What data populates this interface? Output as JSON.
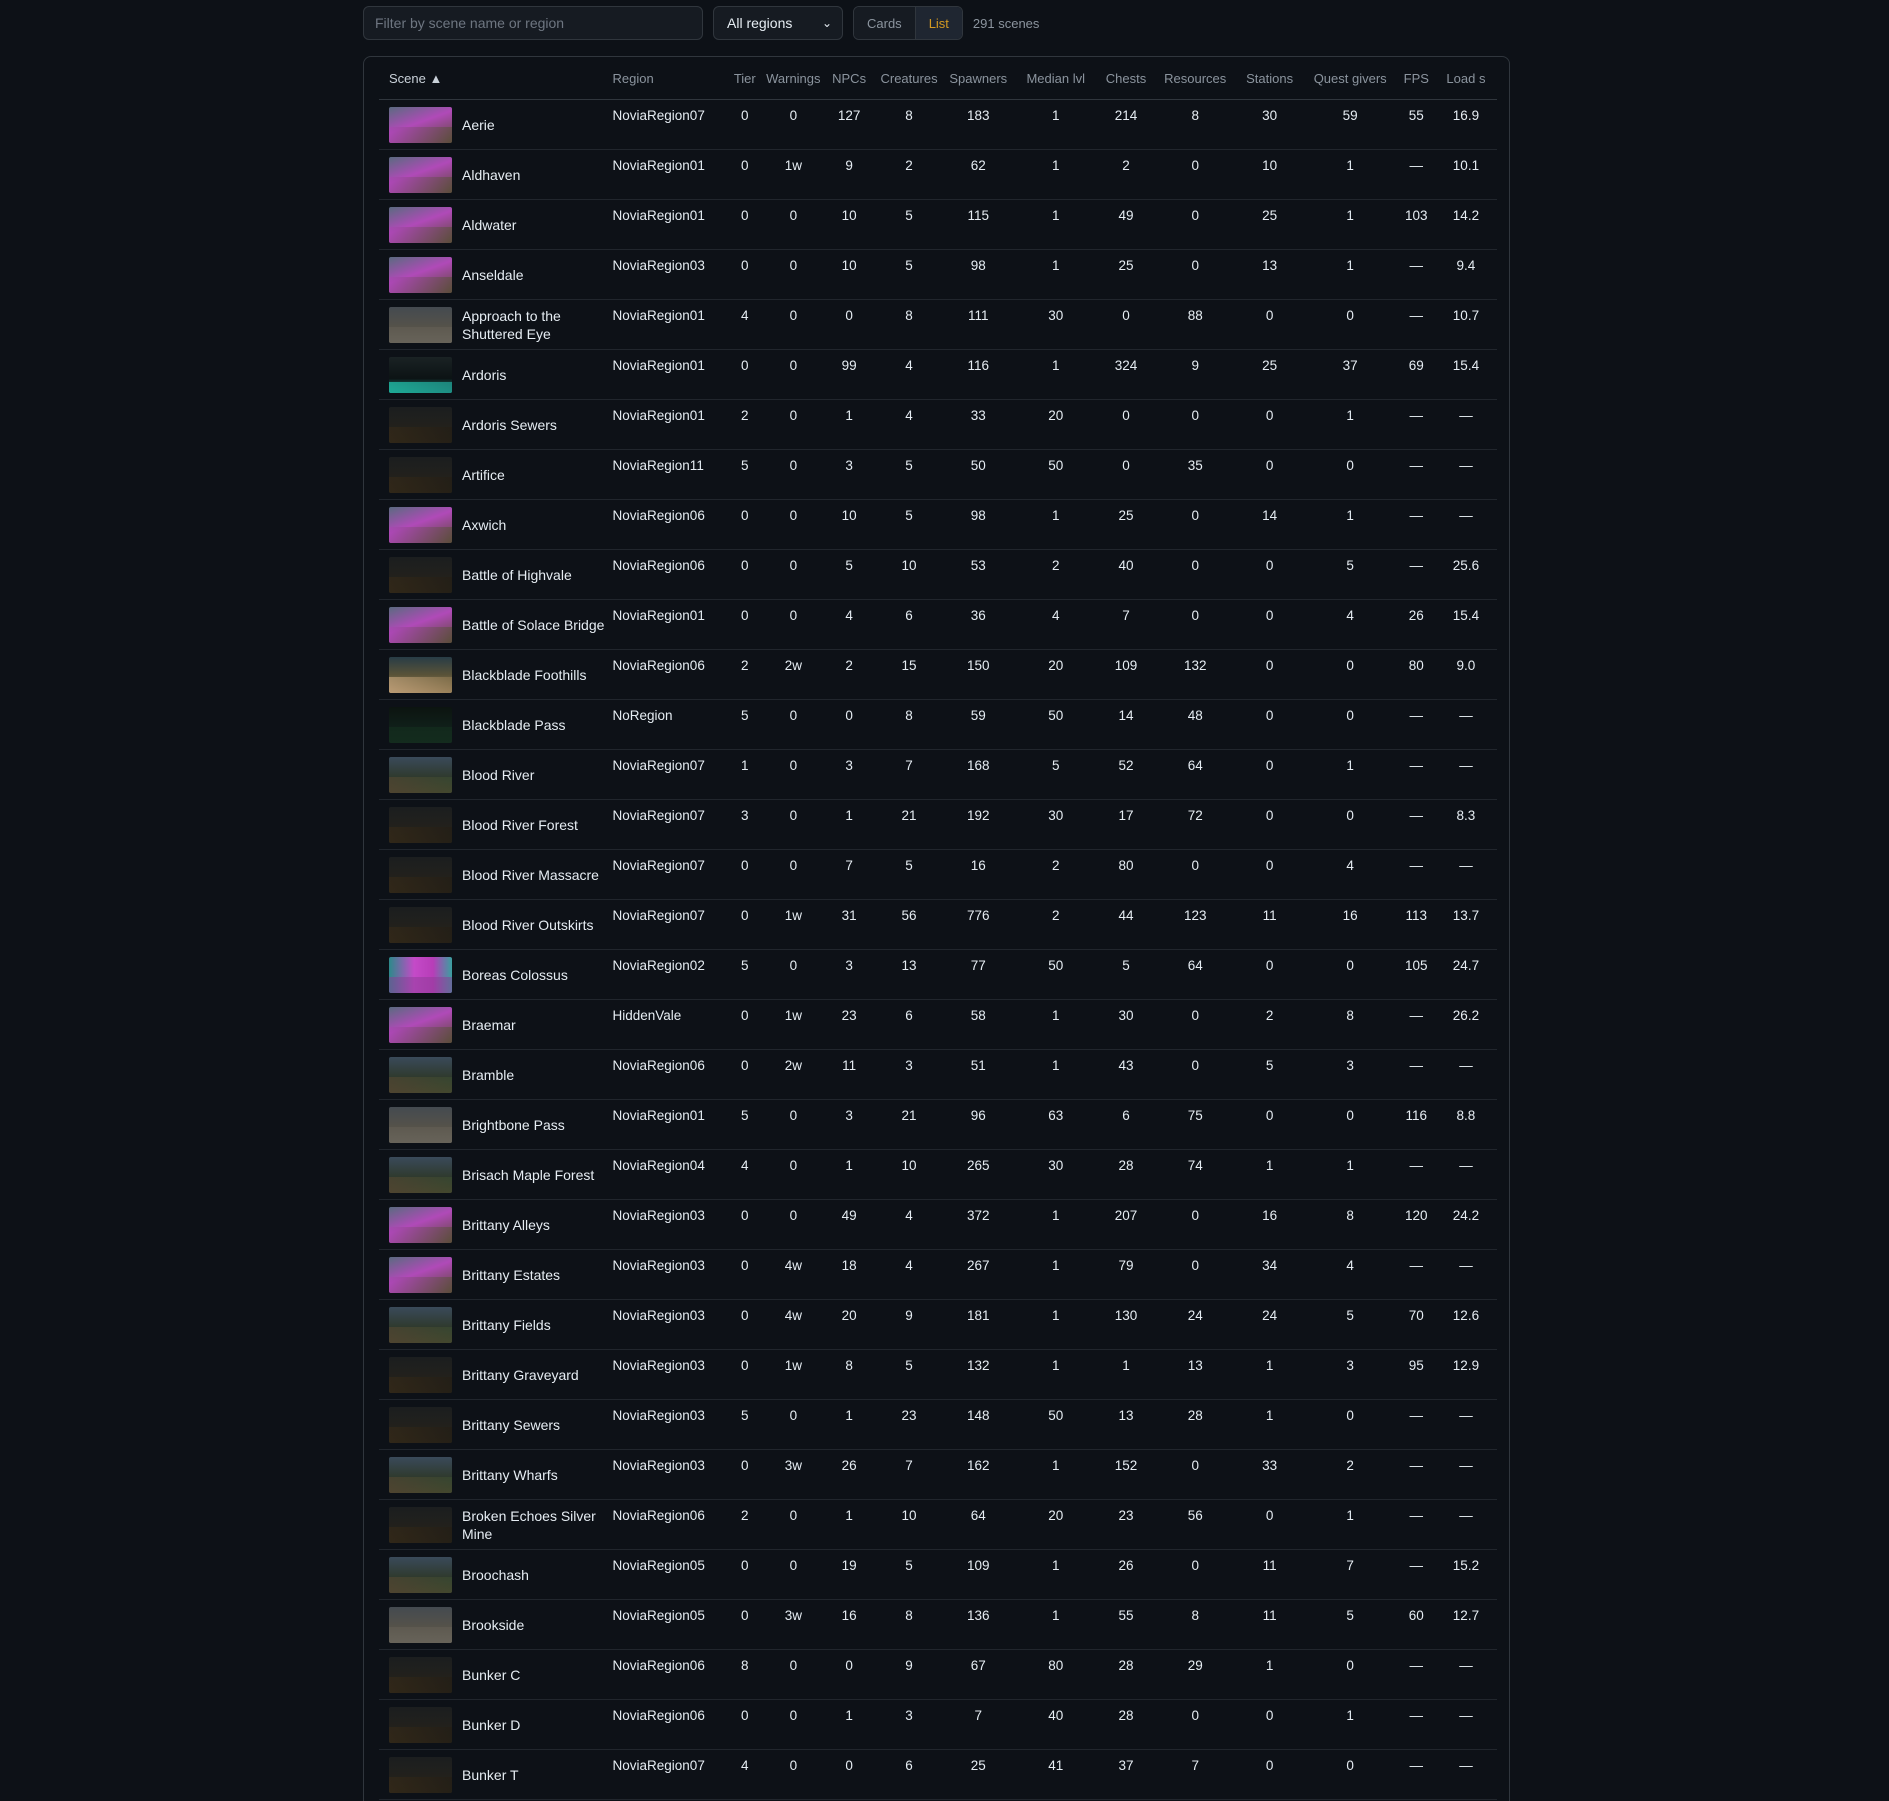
{
  "toolbar": {
    "search_placeholder": "Filter by scene name or region",
    "region_select": "All regions",
    "view_cards": "Cards",
    "view_list": "List",
    "scene_count": "291 scenes"
  },
  "columns": [
    "Scene ▲",
    "Region",
    "Tier",
    "Warnings",
    "NPCs",
    "Creatures",
    "Spawners",
    "Median lvl",
    "Chests",
    "Resources",
    "Stations",
    "Quest givers",
    "FPS",
    "Load s"
  ],
  "rows": [
    {
      "name": "Aerie",
      "thumb": "magenta",
      "region": "NoviaRegion07",
      "tier": "0",
      "warnings": "0",
      "npcs": "127",
      "creatures": "8",
      "spawners": "183",
      "median_lvl": "1",
      "chests": "214",
      "resources": "8",
      "stations": "30",
      "quest_givers": "59",
      "fps": "55",
      "load": "16.9"
    },
    {
      "name": "Aldhaven",
      "thumb": "magenta",
      "region": "NoviaRegion01",
      "tier": "0",
      "warnings": "1w",
      "npcs": "9",
      "creatures": "2",
      "spawners": "62",
      "median_lvl": "1",
      "chests": "2",
      "resources": "0",
      "stations": "10",
      "quest_givers": "1",
      "fps": "—",
      "load": "10.1"
    },
    {
      "name": "Aldwater",
      "thumb": "magenta",
      "region": "NoviaRegion01",
      "tier": "0",
      "warnings": "0",
      "npcs": "10",
      "creatures": "5",
      "spawners": "115",
      "median_lvl": "1",
      "chests": "49",
      "resources": "0",
      "stations": "25",
      "quest_givers": "1",
      "fps": "103",
      "load": "14.2"
    },
    {
      "name": "Anseldale",
      "thumb": "magenta",
      "region": "NoviaRegion03",
      "tier": "0",
      "warnings": "0",
      "npcs": "10",
      "creatures": "5",
      "spawners": "98",
      "median_lvl": "1",
      "chests": "25",
      "resources": "0",
      "stations": "13",
      "quest_givers": "1",
      "fps": "—",
      "load": "9.4"
    },
    {
      "name": "Approach to the Shuttered Eye",
      "thumb": "stone",
      "region": "NoviaRegion01",
      "tier": "4",
      "warnings": "0",
      "npcs": "0",
      "creatures": "8",
      "spawners": "111",
      "median_lvl": "30",
      "chests": "0",
      "resources": "88",
      "stations": "0",
      "quest_givers": "0",
      "fps": "—",
      "load": "10.7"
    },
    {
      "name": "Ardoris",
      "thumb": "teal",
      "region": "NoviaRegion01",
      "tier": "0",
      "warnings": "0",
      "npcs": "99",
      "creatures": "4",
      "spawners": "116",
      "median_lvl": "1",
      "chests": "324",
      "resources": "9",
      "stations": "25",
      "quest_givers": "37",
      "fps": "69",
      "load": "15.4"
    },
    {
      "name": "Ardoris Sewers",
      "thumb": "dark",
      "region": "NoviaRegion01",
      "tier": "2",
      "warnings": "0",
      "npcs": "1",
      "creatures": "4",
      "spawners": "33",
      "median_lvl": "20",
      "chests": "0",
      "resources": "0",
      "stations": "0",
      "quest_givers": "1",
      "fps": "—",
      "load": "—"
    },
    {
      "name": "Artifice",
      "thumb": "dark",
      "region": "NoviaRegion11",
      "tier": "5",
      "warnings": "0",
      "npcs": "3",
      "creatures": "5",
      "spawners": "50",
      "median_lvl": "50",
      "chests": "0",
      "resources": "35",
      "stations": "0",
      "quest_givers": "0",
      "fps": "—",
      "load": "—"
    },
    {
      "name": "Axwich",
      "thumb": "magenta",
      "region": "NoviaRegion06",
      "tier": "0",
      "warnings": "0",
      "npcs": "10",
      "creatures": "5",
      "spawners": "98",
      "median_lvl": "1",
      "chests": "25",
      "resources": "0",
      "stations": "14",
      "quest_givers": "1",
      "fps": "—",
      "load": "—"
    },
    {
      "name": "Battle of Highvale",
      "thumb": "dark",
      "region": "NoviaRegion06",
      "tier": "0",
      "warnings": "0",
      "npcs": "5",
      "creatures": "10",
      "spawners": "53",
      "median_lvl": "2",
      "chests": "40",
      "resources": "0",
      "stations": "0",
      "quest_givers": "5",
      "fps": "—",
      "load": "25.6"
    },
    {
      "name": "Battle of Solace Bridge",
      "thumb": "magenta",
      "region": "NoviaRegion01",
      "tier": "0",
      "warnings": "0",
      "npcs": "4",
      "creatures": "6",
      "spawners": "36",
      "median_lvl": "4",
      "chests": "7",
      "resources": "0",
      "stations": "0",
      "quest_givers": "4",
      "fps": "26",
      "load": "15.4"
    },
    {
      "name": "Blackblade Foothills",
      "thumb": "warm",
      "region": "NoviaRegion06",
      "tier": "2",
      "warnings": "2w",
      "npcs": "2",
      "creatures": "15",
      "spawners": "150",
      "median_lvl": "20",
      "chests": "109",
      "resources": "132",
      "stations": "0",
      "quest_givers": "0",
      "fps": "80",
      "load": "9.0"
    },
    {
      "name": "Blackblade Pass",
      "thumb": "green",
      "region": "NoRegion",
      "tier": "5",
      "warnings": "0",
      "npcs": "0",
      "creatures": "8",
      "spawners": "59",
      "median_lvl": "50",
      "chests": "14",
      "resources": "48",
      "stations": "0",
      "quest_givers": "0",
      "fps": "—",
      "load": "—"
    },
    {
      "name": "Blood River",
      "thumb": "normal",
      "region": "NoviaRegion07",
      "tier": "1",
      "warnings": "0",
      "npcs": "3",
      "creatures": "7",
      "spawners": "168",
      "median_lvl": "5",
      "chests": "52",
      "resources": "64",
      "stations": "0",
      "quest_givers": "1",
      "fps": "—",
      "load": "—"
    },
    {
      "name": "Blood River Forest",
      "thumb": "dark",
      "region": "NoviaRegion07",
      "tier": "3",
      "warnings": "0",
      "npcs": "1",
      "creatures": "21",
      "spawners": "192",
      "median_lvl": "30",
      "chests": "17",
      "resources": "72",
      "stations": "0",
      "quest_givers": "0",
      "fps": "—",
      "load": "8.3"
    },
    {
      "name": "Blood River Massacre",
      "thumb": "dark",
      "region": "NoviaRegion07",
      "tier": "0",
      "warnings": "0",
      "npcs": "7",
      "creatures": "5",
      "spawners": "16",
      "median_lvl": "2",
      "chests": "80",
      "resources": "0",
      "stations": "0",
      "quest_givers": "4",
      "fps": "—",
      "load": "—"
    },
    {
      "name": "Blood River Outskirts",
      "thumb": "dark",
      "region": "NoviaRegion07",
      "tier": "0",
      "warnings": "1w",
      "npcs": "31",
      "creatures": "56",
      "spawners": "776",
      "median_lvl": "2",
      "chests": "44",
      "resources": "123",
      "stations": "11",
      "quest_givers": "16",
      "fps": "113",
      "load": "13.7"
    },
    {
      "name": "Boreas Colossus",
      "thumb": "pinkwall",
      "region": "NoviaRegion02",
      "tier": "5",
      "warnings": "0",
      "npcs": "3",
      "creatures": "13",
      "spawners": "77",
      "median_lvl": "50",
      "chests": "5",
      "resources": "64",
      "stations": "0",
      "quest_givers": "0",
      "fps": "105",
      "load": "24.7"
    },
    {
      "name": "Braemar",
      "thumb": "magenta",
      "region": "HiddenVale",
      "tier": "0",
      "warnings": "1w",
      "npcs": "23",
      "creatures": "6",
      "spawners": "58",
      "median_lvl": "1",
      "chests": "30",
      "resources": "0",
      "stations": "2",
      "quest_givers": "8",
      "fps": "—",
      "load": "26.2"
    },
    {
      "name": "Bramble",
      "thumb": "normal",
      "region": "NoviaRegion06",
      "tier": "0",
      "warnings": "2w",
      "npcs": "11",
      "creatures": "3",
      "spawners": "51",
      "median_lvl": "1",
      "chests": "43",
      "resources": "0",
      "stations": "5",
      "quest_givers": "3",
      "fps": "—",
      "load": "—"
    },
    {
      "name": "Brightbone Pass",
      "thumb": "stone",
      "region": "NoviaRegion01",
      "tier": "5",
      "warnings": "0",
      "npcs": "3",
      "creatures": "21",
      "spawners": "96",
      "median_lvl": "63",
      "chests": "6",
      "resources": "75",
      "stations": "0",
      "quest_givers": "0",
      "fps": "116",
      "load": "8.8"
    },
    {
      "name": "Brisach Maple Forest",
      "thumb": "normal",
      "region": "NoviaRegion04",
      "tier": "4",
      "warnings": "0",
      "npcs": "1",
      "creatures": "10",
      "spawners": "265",
      "median_lvl": "30",
      "chests": "28",
      "resources": "74",
      "stations": "1",
      "quest_givers": "1",
      "fps": "—",
      "load": "—"
    },
    {
      "name": "Brittany Alleys",
      "thumb": "magenta",
      "region": "NoviaRegion03",
      "tier": "0",
      "warnings": "0",
      "npcs": "49",
      "creatures": "4",
      "spawners": "372",
      "median_lvl": "1",
      "chests": "207",
      "resources": "0",
      "stations": "16",
      "quest_givers": "8",
      "fps": "120",
      "load": "24.2"
    },
    {
      "name": "Brittany Estates",
      "thumb": "magenta",
      "region": "NoviaRegion03",
      "tier": "0",
      "warnings": "4w",
      "npcs": "18",
      "creatures": "4",
      "spawners": "267",
      "median_lvl": "1",
      "chests": "79",
      "resources": "0",
      "stations": "34",
      "quest_givers": "4",
      "fps": "—",
      "load": "—"
    },
    {
      "name": "Brittany Fields",
      "thumb": "normal",
      "region": "NoviaRegion03",
      "tier": "0",
      "warnings": "4w",
      "npcs": "20",
      "creatures": "9",
      "spawners": "181",
      "median_lvl": "1",
      "chests": "130",
      "resources": "24",
      "stations": "24",
      "quest_givers": "5",
      "fps": "70",
      "load": "12.6"
    },
    {
      "name": "Brittany Graveyard",
      "thumb": "dark",
      "region": "NoviaRegion03",
      "tier": "0",
      "warnings": "1w",
      "npcs": "8",
      "creatures": "5",
      "spawners": "132",
      "median_lvl": "1",
      "chests": "1",
      "resources": "13",
      "stations": "1",
      "quest_givers": "3",
      "fps": "95",
      "load": "12.9"
    },
    {
      "name": "Brittany Sewers",
      "thumb": "dark",
      "region": "NoviaRegion03",
      "tier": "5",
      "warnings": "0",
      "npcs": "1",
      "creatures": "23",
      "spawners": "148",
      "median_lvl": "50",
      "chests": "13",
      "resources": "28",
      "stations": "1",
      "quest_givers": "0",
      "fps": "—",
      "load": "—"
    },
    {
      "name": "Brittany Wharfs",
      "thumb": "normal",
      "region": "NoviaRegion03",
      "tier": "0",
      "warnings": "3w",
      "npcs": "26",
      "creatures": "7",
      "spawners": "162",
      "median_lvl": "1",
      "chests": "152",
      "resources": "0",
      "stations": "33",
      "quest_givers": "2",
      "fps": "—",
      "load": "—"
    },
    {
      "name": "Broken Echoes Silver Mine",
      "thumb": "dark",
      "region": "NoviaRegion06",
      "tier": "2",
      "warnings": "0",
      "npcs": "1",
      "creatures": "10",
      "spawners": "64",
      "median_lvl": "20",
      "chests": "23",
      "resources": "56",
      "stations": "0",
      "quest_givers": "1",
      "fps": "—",
      "load": "—"
    },
    {
      "name": "Broochash",
      "thumb": "normal",
      "region": "NoviaRegion05",
      "tier": "0",
      "warnings": "0",
      "npcs": "19",
      "creatures": "5",
      "spawners": "109",
      "median_lvl": "1",
      "chests": "26",
      "resources": "0",
      "stations": "11",
      "quest_givers": "7",
      "fps": "—",
      "load": "15.2"
    },
    {
      "name": "Brookside",
      "thumb": "stone",
      "region": "NoviaRegion05",
      "tier": "0",
      "warnings": "3w",
      "npcs": "16",
      "creatures": "8",
      "spawners": "136",
      "median_lvl": "1",
      "chests": "55",
      "resources": "8",
      "stations": "11",
      "quest_givers": "5",
      "fps": "60",
      "load": "12.7"
    },
    {
      "name": "Bunker C",
      "thumb": "dark",
      "region": "NoviaRegion06",
      "tier": "8",
      "warnings": "0",
      "npcs": "0",
      "creatures": "9",
      "spawners": "67",
      "median_lvl": "80",
      "chests": "28",
      "resources": "29",
      "stations": "1",
      "quest_givers": "0",
      "fps": "—",
      "load": "—"
    },
    {
      "name": "Bunker D",
      "thumb": "dark",
      "region": "NoviaRegion06",
      "tier": "0",
      "warnings": "0",
      "npcs": "1",
      "creatures": "3",
      "spawners": "7",
      "median_lvl": "40",
      "chests": "28",
      "resources": "0",
      "stations": "0",
      "quest_givers": "1",
      "fps": "—",
      "load": "—"
    },
    {
      "name": "Bunker T",
      "thumb": "dark",
      "region": "NoviaRegion07",
      "tier": "4",
      "warnings": "0",
      "npcs": "0",
      "creatures": "6",
      "spawners": "25",
      "median_lvl": "41",
      "chests": "37",
      "resources": "7",
      "stations": "0",
      "quest_givers": "0",
      "fps": "—",
      "load": "—"
    }
  ]
}
